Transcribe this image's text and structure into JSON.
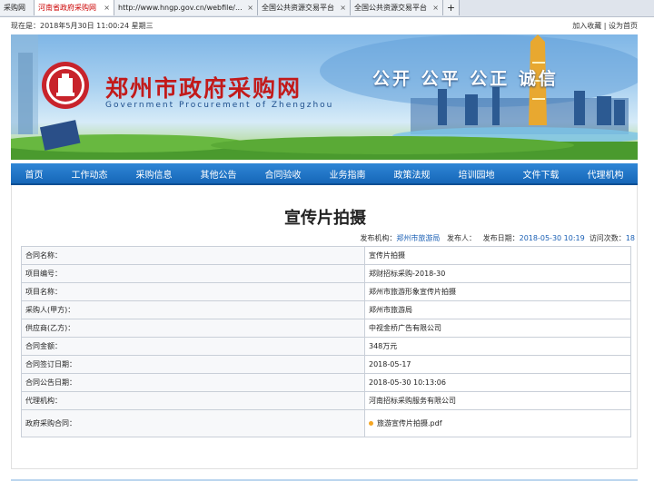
{
  "browser": {
    "tabs": [
      {
        "label": "采购网",
        "active": false
      },
      {
        "label": "河南省政府采购网",
        "active": true
      },
      {
        "label": "http://www.hngp.gov.cn/webfile/...",
        "active": false
      },
      {
        "label": "全国公共资源交易平台",
        "active": false
      },
      {
        "label": "全国公共资源交易平台",
        "active": false
      }
    ],
    "close_glyph": "×",
    "new_tab_glyph": "+"
  },
  "topbar": {
    "datetime": "现在是：2018年5月30日 11:00:24 星期三",
    "add_favorite": "加入收藏",
    "separator": " | ",
    "set_home": "设为首页"
  },
  "banner": {
    "title": "郑州市政府采购网",
    "subtitle": "Government Procurement of Zhengzhou",
    "slogan": "公开 公平 公正 诚信"
  },
  "nav": [
    "首页",
    "工作动态",
    "采购信息",
    "其他公告",
    "合同验收",
    "业务指南",
    "政策法规",
    "培训园地",
    "文件下载",
    "代理机构"
  ],
  "article": {
    "title": "宣传片拍摄",
    "meta": {
      "publisher_label": "发布机构：",
      "publisher": "郑州市旅游局",
      "author_label": "发布人：",
      "date_label": "发布日期：",
      "date": "2018-05-30 10:19",
      "views_label": "访问次数：",
      "views": "18"
    },
    "rows": [
      {
        "label": "合同名称：",
        "value": "宣传片拍摄"
      },
      {
        "label": "项目编号：",
        "value": "郑财招标采购-2018-30"
      },
      {
        "label": "项目名称：",
        "value": "郑州市旅游形象宣传片拍摄"
      },
      {
        "label": "采购人(甲方)：",
        "value": "郑州市旅游局"
      },
      {
        "label": "供应商(乙方)：",
        "value": "中视金桥广告有限公司"
      },
      {
        "label": "合同金额：",
        "value": "348万元"
      },
      {
        "label": "合同签订日期：",
        "value": "2018-05-17"
      },
      {
        "label": "合同公告日期：",
        "value": "2018-05-30 10:13:06"
      },
      {
        "label": "代理机构：",
        "value": "河南招标采购服务有限公司"
      }
    ],
    "attachment_row": {
      "label": "政府采购合同：",
      "file": "旅游宣传片拍摄.pdf"
    }
  }
}
